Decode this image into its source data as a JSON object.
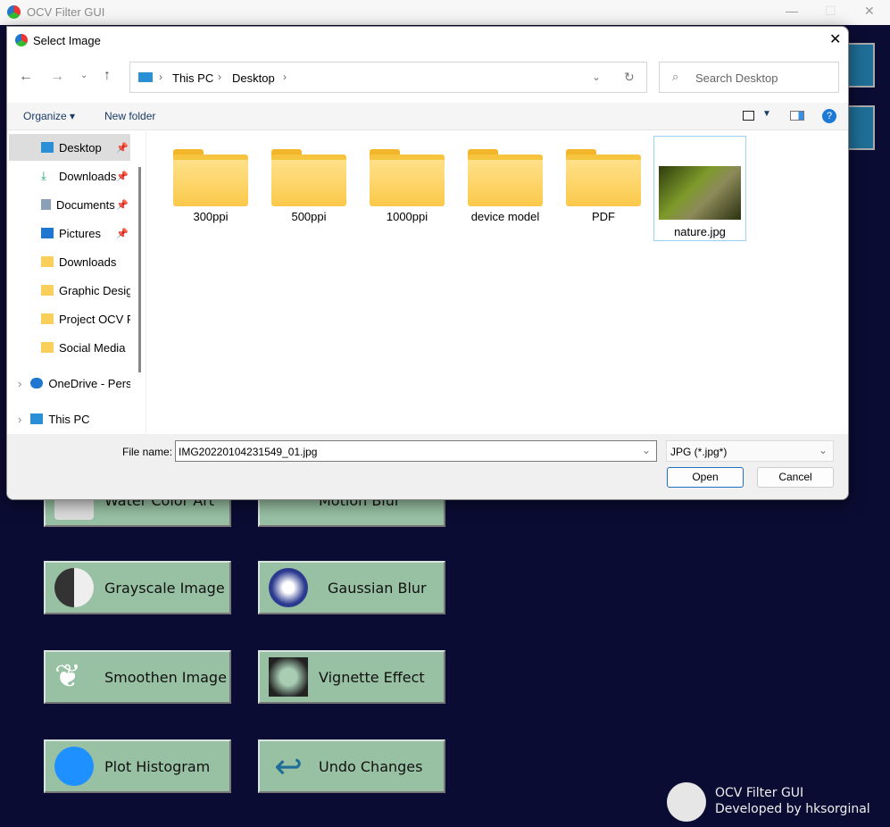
{
  "app": {
    "title": "OCV Filter GUI",
    "footer_title": "OCV Filter GUI",
    "footer_sub": "Developed by hksorginal",
    "buttons": [
      {
        "label": "Water Color Art"
      },
      {
        "label": "Motion Blur"
      },
      {
        "label": "Grayscale Image"
      },
      {
        "label": "Gaussian Blur"
      },
      {
        "label": "Smoothen Image"
      },
      {
        "label": "Vignette Effect"
      },
      {
        "label": "Plot Histogram"
      },
      {
        "label": "Undo Changes"
      }
    ],
    "colors": {
      "background": "#0b0c33",
      "button": "#98c1a3"
    }
  },
  "dialog": {
    "title": "Select Image",
    "breadcrumb": [
      "This PC",
      "Desktop"
    ],
    "search_placeholder": "Search Desktop",
    "toolbar": {
      "organize": "Organize",
      "new_folder": "New folder"
    },
    "nav": [
      {
        "label": "Desktop",
        "pinned": true,
        "selected": true
      },
      {
        "label": "Downloads",
        "pinned": true
      },
      {
        "label": "Documents",
        "pinned": true
      },
      {
        "label": "Pictures",
        "pinned": true
      },
      {
        "label": "Downloads"
      },
      {
        "label": "Graphic Design"
      },
      {
        "label": "Project OCV Filter"
      },
      {
        "label": "Social Media"
      },
      {
        "label": "OneDrive - Personal"
      },
      {
        "label": "This PC"
      }
    ],
    "items": [
      {
        "name": "300ppi",
        "type": "folder"
      },
      {
        "name": "500ppi",
        "type": "folder"
      },
      {
        "name": "1000ppi",
        "type": "folder"
      },
      {
        "name": "device model",
        "type": "folder"
      },
      {
        "name": "PDF",
        "type": "folder"
      },
      {
        "name": "nature.jpg",
        "type": "image"
      }
    ],
    "file_name_label": "File name:",
    "file_name": "IMG20220104231549_01.jpg",
    "file_type": "JPG (*.jpg*)",
    "open": "Open",
    "cancel": "Cancel"
  }
}
